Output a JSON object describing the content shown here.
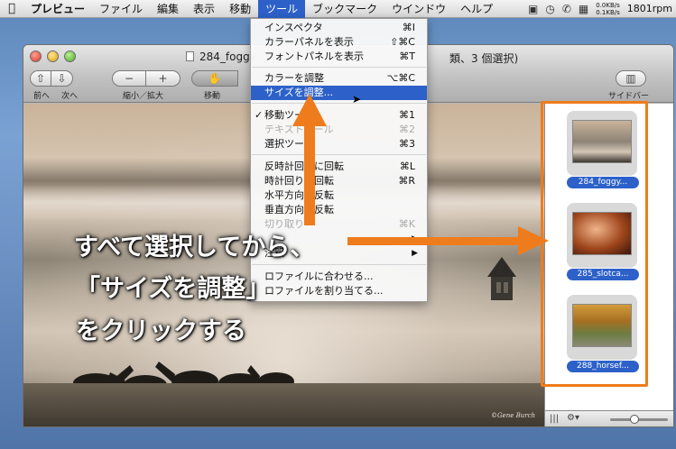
{
  "menubar": {
    "items": [
      "プレビュー",
      "ファイル",
      "編集",
      "表示",
      "移動",
      "ツール",
      "ブックマーク",
      "ウインドウ",
      "ヘルプ"
    ],
    "active": "ツール",
    "netrate_up": "0.0KB/s",
    "netrate_down": "0.1KB/s",
    "rpm": "1801rpm"
  },
  "window": {
    "title": "284_foggy",
    "title_tail": "類、3 個選択)",
    "toolbar": {
      "back_label": "前へ",
      "next_label": "次へ",
      "zoom_label": "縮小／拡大",
      "move_label": "移動",
      "sidebar_label": "サイドバー"
    },
    "watermark": "©Gene Burch"
  },
  "sidebar": {
    "items": [
      {
        "label": "284_foggy..."
      },
      {
        "label": "285_slotca..."
      },
      {
        "label": "288_horsef..."
      }
    ]
  },
  "dropdown": {
    "items": [
      {
        "label": "インスペクタ",
        "shortcut": "⌘I"
      },
      {
        "label": "カラーパネルを表示",
        "shortcut": "⇧⌘C"
      },
      {
        "label": "フォントパネルを表示",
        "shortcut": "⌘T"
      },
      {
        "label": "カラーを調整",
        "shortcut": "⌥⌘C"
      },
      {
        "label": "サイズを調整...",
        "shortcut": ""
      },
      {
        "label": "移動ツー",
        "shortcut": "⌘1"
      },
      {
        "label": "テキストツール",
        "shortcut": "⌘2"
      },
      {
        "label": "選択ツー",
        "shortcut": "⌘3"
      },
      {
        "label": "反時計回りに回転",
        "shortcut": "⌘L"
      },
      {
        "label": "時計回りに回転",
        "shortcut": "⌘R"
      },
      {
        "label": "水平方向に反転",
        "shortcut": ""
      },
      {
        "label": "垂直方向に反転",
        "shortcut": ""
      },
      {
        "label": "切り取り",
        "shortcut": "⌘K"
      },
      {
        "label": "",
        "shortcut": ""
      },
      {
        "label": "注釈",
        "shortcut": ""
      },
      {
        "label": "ロファイルに合わせる...",
        "shortcut": ""
      },
      {
        "label": "ロファイルを割り当てる...",
        "shortcut": ""
      }
    ]
  },
  "annotation": {
    "line1": "すべて選択してから、",
    "line2": "「サイズを調整」",
    "line3": "をクリックする"
  },
  "colors": {
    "highlight": "#2d61c9",
    "annotation_orange": "#ef7c1c"
  }
}
